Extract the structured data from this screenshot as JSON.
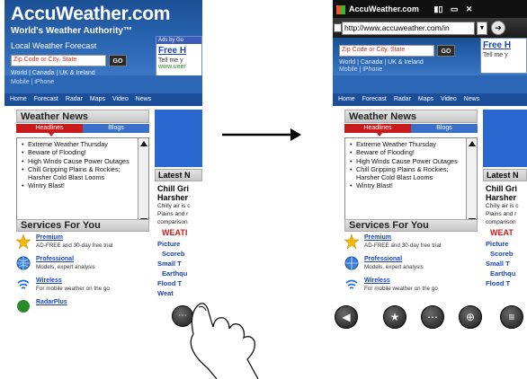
{
  "left": {
    "logo": "AccuWeather.com",
    "tagline": "World's Weather Authority™",
    "local_forecast": "Local Weather Forecast",
    "zip_placeholder": "Zip Code or City, State",
    "go": "GO",
    "world_links": "World | Canada | UK & Ireland",
    "mobile_links": "Mobile | iPhone",
    "ad": {
      "ads_by": "Ads by Go",
      "free": "Free H",
      "tell": "Tell me y",
      "link": "www.ueer"
    },
    "nav": [
      "Home",
      "Forecast",
      "Radar",
      "Maps",
      "Video",
      "News"
    ],
    "weather_news": {
      "title": "Weather News",
      "tab_headlines": "Headlines",
      "tab_blogs": "Blogs",
      "items": [
        "Extreme Weather Thursday",
        "Beware of Flooding!",
        "High Winds Cause Power Outages",
        "Chill Gripping Plains & Rockies; Harsher Cold Blast Looms",
        "Wintry Blast!"
      ]
    },
    "services": {
      "title": "Services For You",
      "items": [
        {
          "name": "Premium",
          "desc": "AD-FREE and 30-day free trial"
        },
        {
          "name": "Professional",
          "desc": "Models, expert analysis"
        },
        {
          "name": "Wireless",
          "desc": "For mobile weather on the go"
        },
        {
          "name": "RadarPlus",
          "desc": ""
        }
      ]
    },
    "latest": {
      "title": "Latest N",
      "story1": "Chill Gri",
      "story2": "Harsher",
      "body1": "Chilly air is c",
      "body2": "Plains and r",
      "body3": "comparison",
      "weat": "WEATI",
      "link1": "Picture",
      "link1b": "Scoreb",
      "link2": "Small T",
      "link2b": "Earthqu",
      "link3": "Flood T",
      "link4": "Weat"
    }
  },
  "right": {
    "title": "AccuWeather.com",
    "url": "http://www.accuweather.com/in",
    "zip_placeholder": "Zip Code or City, State",
    "go": "GO",
    "world_links": "World | Canada | UK & Ireland",
    "mobile_links": "Mobile | iPhone",
    "ad": {
      "free": "Free H",
      "tell": "Tell me y"
    },
    "nav": [
      "Home",
      "Forecast",
      "Radar",
      "Maps",
      "Video",
      "News"
    ],
    "weather_news": {
      "title": "Weather News",
      "tab_headlines": "Headlines",
      "tab_blogs": "Blogs",
      "items": [
        "Extreme Weather Thursday",
        "Beware of Flooding!",
        "High Winds Cause Power Outages",
        "Chill Gripping Plains & Rockies; Harsher Cold Blast Looms",
        "Wintry Blast!"
      ]
    },
    "services": {
      "title": "Services For You",
      "items": [
        {
          "name": "Premium",
          "desc": "AD-FREE and 30-day free trial"
        },
        {
          "name": "Professional",
          "desc": "Models, expert analysis"
        },
        {
          "name": "Wireless",
          "desc": "For mobile weather on the go"
        }
      ]
    },
    "latest": {
      "title": "Latest N",
      "story1": "Chill Gri",
      "story2": "Harsher",
      "body1": "Chilly air is c",
      "body2": "Plains and r",
      "body3": "comparison",
      "weat": "WEAT",
      "link1": "Picture",
      "link1b": "Scoreb",
      "link2": "Small T",
      "link2b": "Earthqu",
      "link3": "Flood T"
    }
  },
  "icons": {
    "back": "back-icon",
    "favorites": "star-icon",
    "menu": "menu-icon",
    "zoom": "zoom-icon",
    "more": "more-icon"
  }
}
